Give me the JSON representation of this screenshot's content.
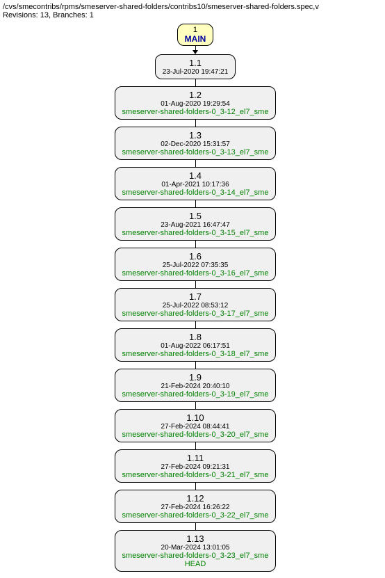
{
  "header": {
    "path": "/cvs/smecontribs/rpms/smeserver-shared-folders/contribs10/smeserver-shared-folders.spec,v",
    "info": "Revisions: 13, Branches: 1"
  },
  "branch": {
    "num": "1",
    "name": "MAIN"
  },
  "revisions": [
    {
      "rev": "1.1",
      "date": "23-Jul-2020 19:47:21",
      "tags": []
    },
    {
      "rev": "1.2",
      "date": "01-Aug-2020 19:29:54",
      "tags": [
        "smeserver-shared-folders-0_3-12_el7_sme"
      ]
    },
    {
      "rev": "1.3",
      "date": "02-Dec-2020 15:31:57",
      "tags": [
        "smeserver-shared-folders-0_3-13_el7_sme"
      ]
    },
    {
      "rev": "1.4",
      "date": "01-Apr-2021 10:17:36",
      "tags": [
        "smeserver-shared-folders-0_3-14_el7_sme"
      ]
    },
    {
      "rev": "1.5",
      "date": "23-Aug-2021 16:47:47",
      "tags": [
        "smeserver-shared-folders-0_3-15_el7_sme"
      ]
    },
    {
      "rev": "1.6",
      "date": "25-Jul-2022 07:35:35",
      "tags": [
        "smeserver-shared-folders-0_3-16_el7_sme"
      ]
    },
    {
      "rev": "1.7",
      "date": "25-Jul-2022 08:53:12",
      "tags": [
        "smeserver-shared-folders-0_3-17_el7_sme"
      ]
    },
    {
      "rev": "1.8",
      "date": "01-Aug-2022 06:17:51",
      "tags": [
        "smeserver-shared-folders-0_3-18_el7_sme"
      ]
    },
    {
      "rev": "1.9",
      "date": "21-Feb-2024 20:40:10",
      "tags": [
        "smeserver-shared-folders-0_3-19_el7_sme"
      ]
    },
    {
      "rev": "1.10",
      "date": "27-Feb-2024 08:44:41",
      "tags": [
        "smeserver-shared-folders-0_3-20_el7_sme"
      ]
    },
    {
      "rev": "1.11",
      "date": "27-Feb-2024 09:21:31",
      "tags": [
        "smeserver-shared-folders-0_3-21_el7_sme"
      ]
    },
    {
      "rev": "1.12",
      "date": "27-Feb-2024 16:26:22",
      "tags": [
        "smeserver-shared-folders-0_3-22_el7_sme"
      ]
    },
    {
      "rev": "1.13",
      "date": "20-Mar-2024 13:01:05",
      "tags": [
        "smeserver-shared-folders-0_3-23_el7_sme",
        "HEAD"
      ]
    }
  ]
}
